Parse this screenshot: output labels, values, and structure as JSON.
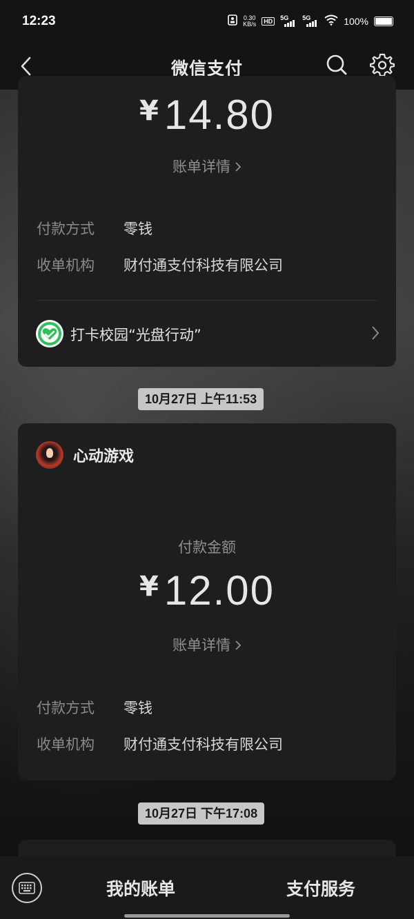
{
  "status_bar": {
    "time": "12:23",
    "net_speed_value": "0.30",
    "net_speed_unit": "KB/s",
    "hd_label": "HD",
    "signal1_label": "5G",
    "signal2_label": "5G",
    "battery_percent": "100%"
  },
  "nav": {
    "title": "微信支付",
    "back_icon": "chevron-left-icon",
    "search_icon": "search-icon",
    "settings_icon": "gear-icon"
  },
  "transactions": [
    {
      "amount_currency": "¥",
      "amount_value": "14.80",
      "detail_link": "账单详情",
      "fields": [
        {
          "key": "付款方式",
          "value": "零钱"
        },
        {
          "key": "收单机构",
          "value": "财付通支付科技有限公司"
        }
      ],
      "promo": {
        "text": "打卡校园“光盘行动”"
      }
    },
    {
      "timestamp": "10月27日 上午11:53",
      "merchant": "心动游戏",
      "pay_label": "付款金额",
      "amount_currency": "¥",
      "amount_value": "12.00",
      "detail_link": "账单详情",
      "fields": [
        {
          "key": "付款方式",
          "value": "零钱"
        },
        {
          "key": "收单机构",
          "value": "财付通支付科技有限公司"
        }
      ]
    },
    {
      "timestamp": "10月27日 下午17:08"
    }
  ],
  "bottom_bar": {
    "keyboard_icon": "keyboard-icon",
    "tab_bills": "我的账单",
    "tab_services": "支付服务"
  },
  "colors": {
    "card_bg": "#1e1e1e",
    "bar_bg": "#141414",
    "pill_bg": "#c7c7c7",
    "promo_icon_green": "#2fbf5b"
  }
}
